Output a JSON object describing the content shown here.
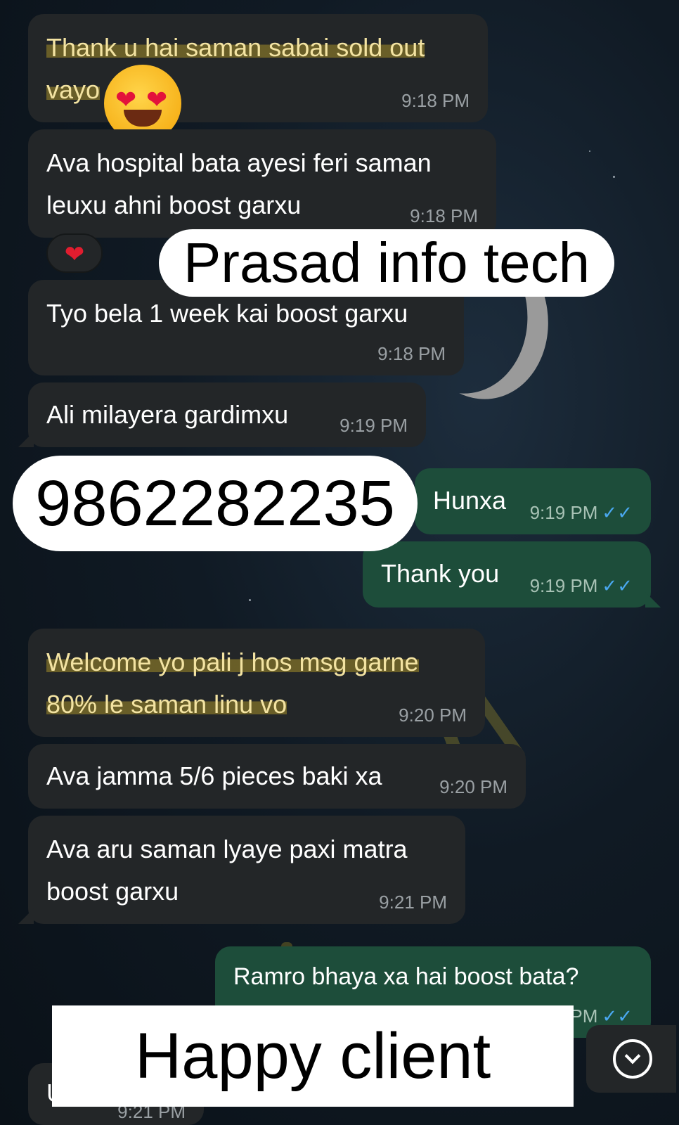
{
  "messages": [
    {
      "text_part1": "Thank u hai saman sabai sold out",
      "text_part2": "vayo",
      "time": "9:18 PM"
    },
    {
      "text": "Ava hospital bata ayesi feri saman\nleuxu ahni boost garxu",
      "time": "9:18 PM"
    },
    {
      "text": "Tyo bela 1 week kai boost garxu",
      "time": "9:18 PM"
    },
    {
      "text": "Ali milayera gardimxu",
      "time": "9:19 PM"
    },
    {
      "text": "Hunxa",
      "time": "9:19 PM"
    },
    {
      "text": "Thank you",
      "time": "9:19 PM"
    },
    {
      "text_line1": "Welcome yo pali j hos msg garne",
      "text_line2": "80% le saman linu vo",
      "time": "9:20 PM"
    },
    {
      "text": "Ava jamma 5/6 pieces baki xa",
      "time": "9:20 PM"
    },
    {
      "text": "Ava aru saman lyaye paxi matra\nboost garxu",
      "time": "9:21 PM"
    },
    {
      "text": "Ramro bhaya xa hai boost bata?",
      "time": "PM"
    },
    {
      "text": "U",
      "time": "9:21 PM"
    }
  ],
  "reaction": {
    "icon": "heart-icon",
    "glyph": "❤",
    "color": "#e11d2f"
  },
  "emoji": {
    "icon": "heart-eyes-emoji-icon"
  },
  "ticks_glyph": "✓✓",
  "overlays": {
    "brand": "Prasad info tech",
    "phone": "9862282235",
    "caption": "Happy client"
  },
  "scroll_button": {
    "icon": "chevron-down-icon"
  },
  "colors": {
    "incoming_bubble": "#232628",
    "outgoing_bubble": "#1d4d3a",
    "read_ticks": "#4aa8f0",
    "highlight": "#ebc828"
  }
}
